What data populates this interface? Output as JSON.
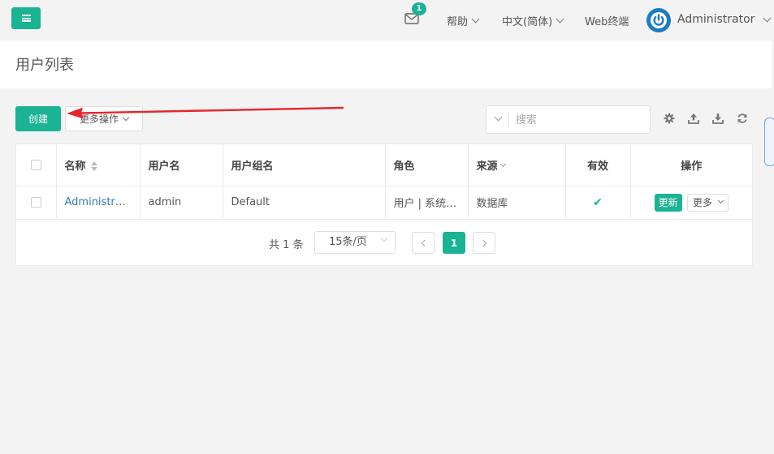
{
  "topbar": {
    "mail_count": "1",
    "help_label": "帮助",
    "language_label": "中文(简体)",
    "web_terminal_label": "Web终端",
    "user_name": "Administrator"
  },
  "page": {
    "title": "用户列表"
  },
  "toolbar": {
    "create_label": "创建",
    "more_ops_label": "更多操作",
    "search_placeholder": "搜索"
  },
  "table": {
    "headers": {
      "name": "名称",
      "username": "用户名",
      "group": "用户组名",
      "role": "角色",
      "source": "来源",
      "active": "有效",
      "actions": "操作"
    },
    "rows": [
      {
        "name": "Administrator",
        "username": "admin",
        "group": "Default",
        "role": "用户 | 系统管理员",
        "source": "数据库",
        "active": "✔",
        "update_label": "更新",
        "more_label": "更多"
      }
    ]
  },
  "pagination": {
    "total_text": "共 1 条",
    "page_size": "15条/页",
    "current_page": "1"
  },
  "colors": {
    "accent": "#1ab394",
    "link": "#337ab7",
    "avatar": "#1c7cc1"
  },
  "icons": {
    "menu": "hamburger-icon",
    "mail": "envelope-icon",
    "settings": "gear-icon",
    "import": "upload-icon",
    "export": "download-icon",
    "refresh": "refresh-icon"
  }
}
